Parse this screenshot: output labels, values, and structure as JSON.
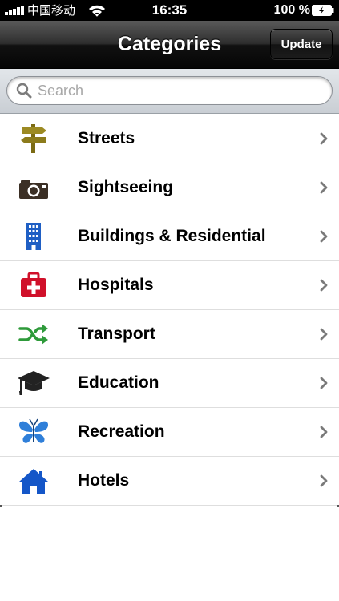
{
  "status_bar": {
    "carrier": "中国移动",
    "time": "16:35",
    "battery": "100 %"
  },
  "nav_bar": {
    "title": "Categories",
    "update_label": "Update"
  },
  "search": {
    "placeholder": "Search",
    "value": ""
  },
  "categories": [
    {
      "label": "Streets",
      "icon": "signpost-icon"
    },
    {
      "label": "Sightseeing",
      "icon": "camera-icon"
    },
    {
      "label": "Buildings & Residential",
      "icon": "building-icon"
    },
    {
      "label": "Hospitals",
      "icon": "first-aid-kit-icon"
    },
    {
      "label": "Transport",
      "icon": "shuffle-arrows-icon"
    },
    {
      "label": "Education",
      "icon": "graduation-cap-icon"
    },
    {
      "label": "Recreation",
      "icon": "butterfly-icon"
    },
    {
      "label": "Hotels",
      "icon": "house-icon"
    }
  ],
  "colors": {
    "streets": "#8b7a1e",
    "sightseeing": "#3b2f25",
    "buildings": "#1f5fc4",
    "hospitals": "#d0102a",
    "transport": "#2e9a3a",
    "education": "#222222",
    "recreation": "#2f7fd9",
    "hotels": "#1456c8"
  }
}
